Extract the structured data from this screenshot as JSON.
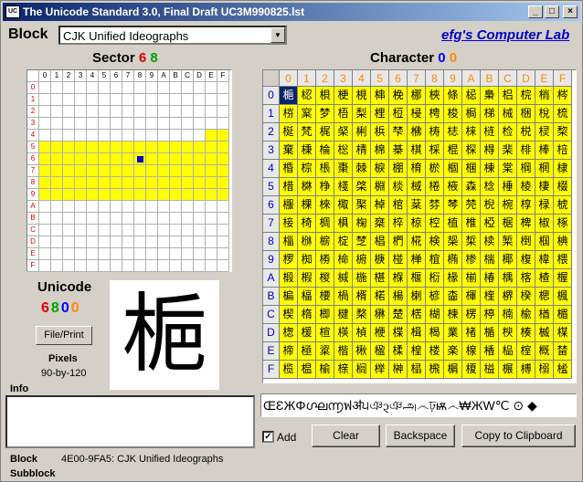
{
  "window": {
    "title": "The Unicode Standard 3.0, Final Draft UC3M990825.lst",
    "icon": "app-icon",
    "min": "_",
    "max": "□",
    "close": "×"
  },
  "block": {
    "label": "Block",
    "selected": "CJK Unified Ideographs"
  },
  "link": "efg's Computer Lab",
  "sector": {
    "label": "Sector",
    "digit1": "6",
    "digit2": "8",
    "cols": [
      "0",
      "1",
      "2",
      "3",
      "4",
      "5",
      "6",
      "7",
      "8",
      "9",
      "A",
      "B",
      "C",
      "D",
      "E",
      "F"
    ],
    "rows": [
      "0",
      "1",
      "2",
      "3",
      "4",
      "5",
      "6",
      "7",
      "8",
      "9",
      "A",
      "B",
      "C",
      "D",
      "E",
      "F"
    ]
  },
  "character": {
    "label": "Character",
    "digit1": "0",
    "digit2": "0",
    "cols": [
      "0",
      "1",
      "2",
      "3",
      "4",
      "5",
      "6",
      "7",
      "8",
      "9",
      "A",
      "B",
      "C",
      "D",
      "E",
      "F"
    ],
    "rows": [
      "0",
      "1",
      "2",
      "3",
      "4",
      "5",
      "6",
      "7",
      "8",
      "9",
      "A",
      "B",
      "C",
      "D",
      "E",
      "F"
    ],
    "glyphs": [
      "梔梕梖梗梘梙梚梛梜條梞梟梠梡梢梣",
      "梤梥梦梧梨梩梪梫梬梭梮梯械梱梲梳",
      "梴梵梶梷梸梹梺梻梼梽梾梿检棁棂棃",
      "棄棅棆棇棈棉棊棋棌棍棎棏棐棑棒棓",
      "棔棕棖棗棘棙棚棛棜棝棞棟棠棡棢棣",
      "棤棥棦棧棨棩棪棫棬棭森棯棰棱棲棳",
      "棴棵棶棷棸棹棺棻棼棽棾棿椀椁椂椃",
      "椄椅椆椇椈椉椊椋椌植椎椏椐椑椒椓",
      "椔椕椖椗椘椙椚椛検椝椞椟椠椡椢椣",
      "椤椥椦椧椨椩椪椫椬椭椮椯椰椱椲椳",
      "椴椵椶椷椸椹椺椻椼椽椾椿楀楁楂楃",
      "楄楅楆楇楈楉楊楋楌楍楎楏楐楑楒楓",
      "楔楕楖楗楘楙楚楛楜楝楞楟楠楡楢楣",
      "楤楥楦楧楨楩楪楫楬業楮楯楰楱楲楳",
      "楴極楶楷楸楹楺楻楼楽楾楿榀榁概榃",
      "榄榅榆榇榈榉榊榋榌榍榎榏榐榑榒榓"
    ]
  },
  "unicode": {
    "label": "Unicode",
    "d1": "6",
    "d2": "8",
    "d3": "0",
    "d4": "0"
  },
  "buttons": {
    "file_print": "File/Print",
    "clear": "Clear",
    "backspace": "Backspace",
    "copy": "Copy to Clipboard"
  },
  "pixels": {
    "label": "Pixels",
    "value": "90-by-120"
  },
  "big_char": "梔",
  "info": {
    "label": "Info",
    "text": ""
  },
  "string_box": "ŒƐЖΦഗ്ഘ൬ฟॳ੫ঞ᧓ঞஅ෴ঢ়ѭ෴₩ЖW℃ ⊙ ◆",
  "add": {
    "label": "Add",
    "checked": "✓"
  },
  "status": {
    "block_label": "Block",
    "block_value": "4E00-9FA5:   CJK Unified Ideographs",
    "subblock_label": "Subblock"
  },
  "colors": {
    "title_bar": "#0a246a",
    "highlight": "#ffff00",
    "selected": "#0a246a",
    "link": "#0000cc"
  }
}
